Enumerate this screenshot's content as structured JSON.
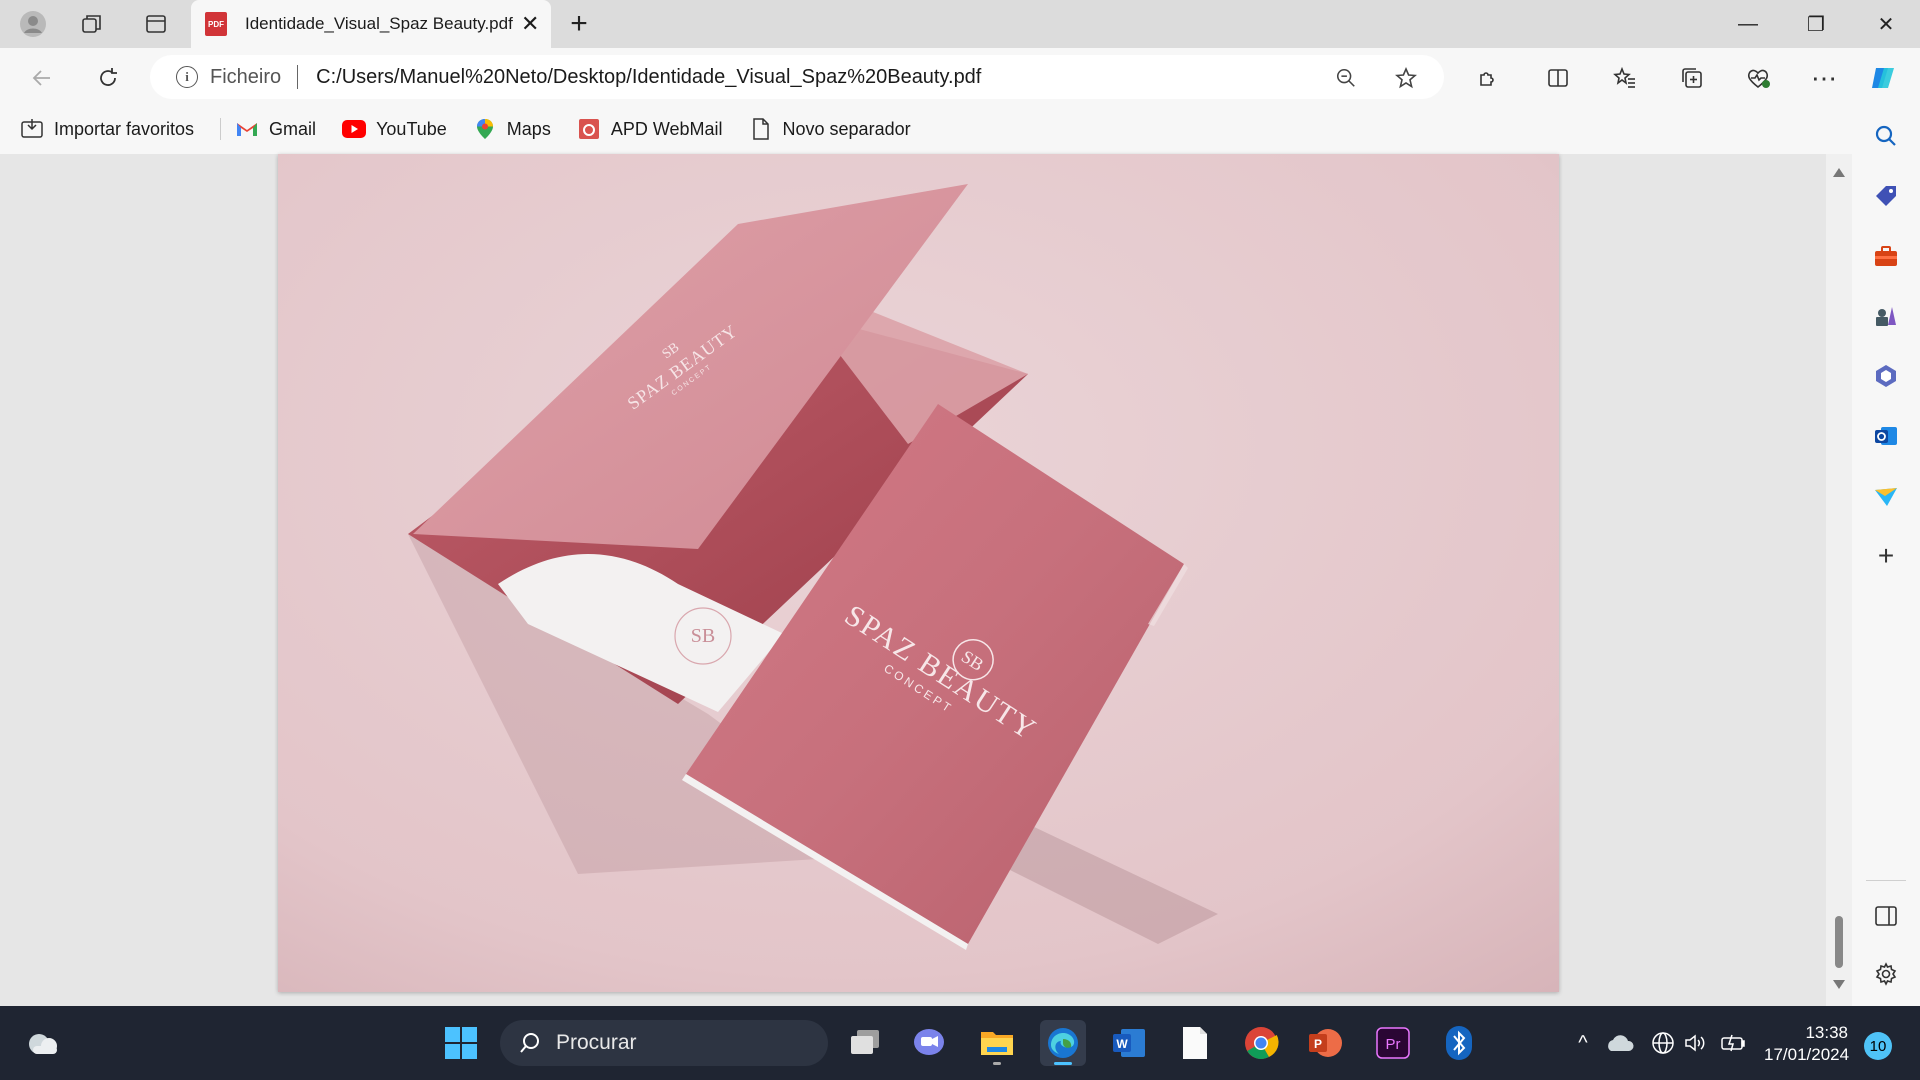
{
  "browser": {
    "tab_title": "Identidade_Visual_Spaz Beauty.pdf",
    "tab_close": "✕",
    "new_tab": "+",
    "pdf_badge": "PDF",
    "window_controls": {
      "minimize": "—",
      "maximize": "❐",
      "close": "✕"
    }
  },
  "address_bar": {
    "scheme_label": "Ficheiro",
    "url": "C:/Users/Manuel%20Neto/Desktop/Identidade_Visual_Spaz%20Beauty.pdf"
  },
  "bookmarks": [
    {
      "label": "Importar favoritos",
      "icon": "import-icon"
    },
    {
      "label": "Gmail",
      "icon": "gmail-icon"
    },
    {
      "label": "YouTube",
      "icon": "youtube-icon"
    },
    {
      "label": "Maps",
      "icon": "maps-icon"
    },
    {
      "label": "APD WebMail",
      "icon": "webmail-icon"
    },
    {
      "label": "Novo separador",
      "icon": "page-icon"
    }
  ],
  "document": {
    "brand_name": "SPAZ BEAUTY",
    "brand_sub": "CONCEPT",
    "monogram": "SB",
    "colors": {
      "folder": "#c9727f",
      "folder_inner": "#a44a55",
      "background": "#e6cbcf",
      "insert": "#f2f0f0"
    }
  },
  "taskbar": {
    "search_placeholder": "Procurar",
    "time": "13:38",
    "date": "17/01/2024",
    "notifications": "10"
  },
  "colors": {
    "accent": "#0067c0",
    "taskbar": "#1f2532"
  }
}
